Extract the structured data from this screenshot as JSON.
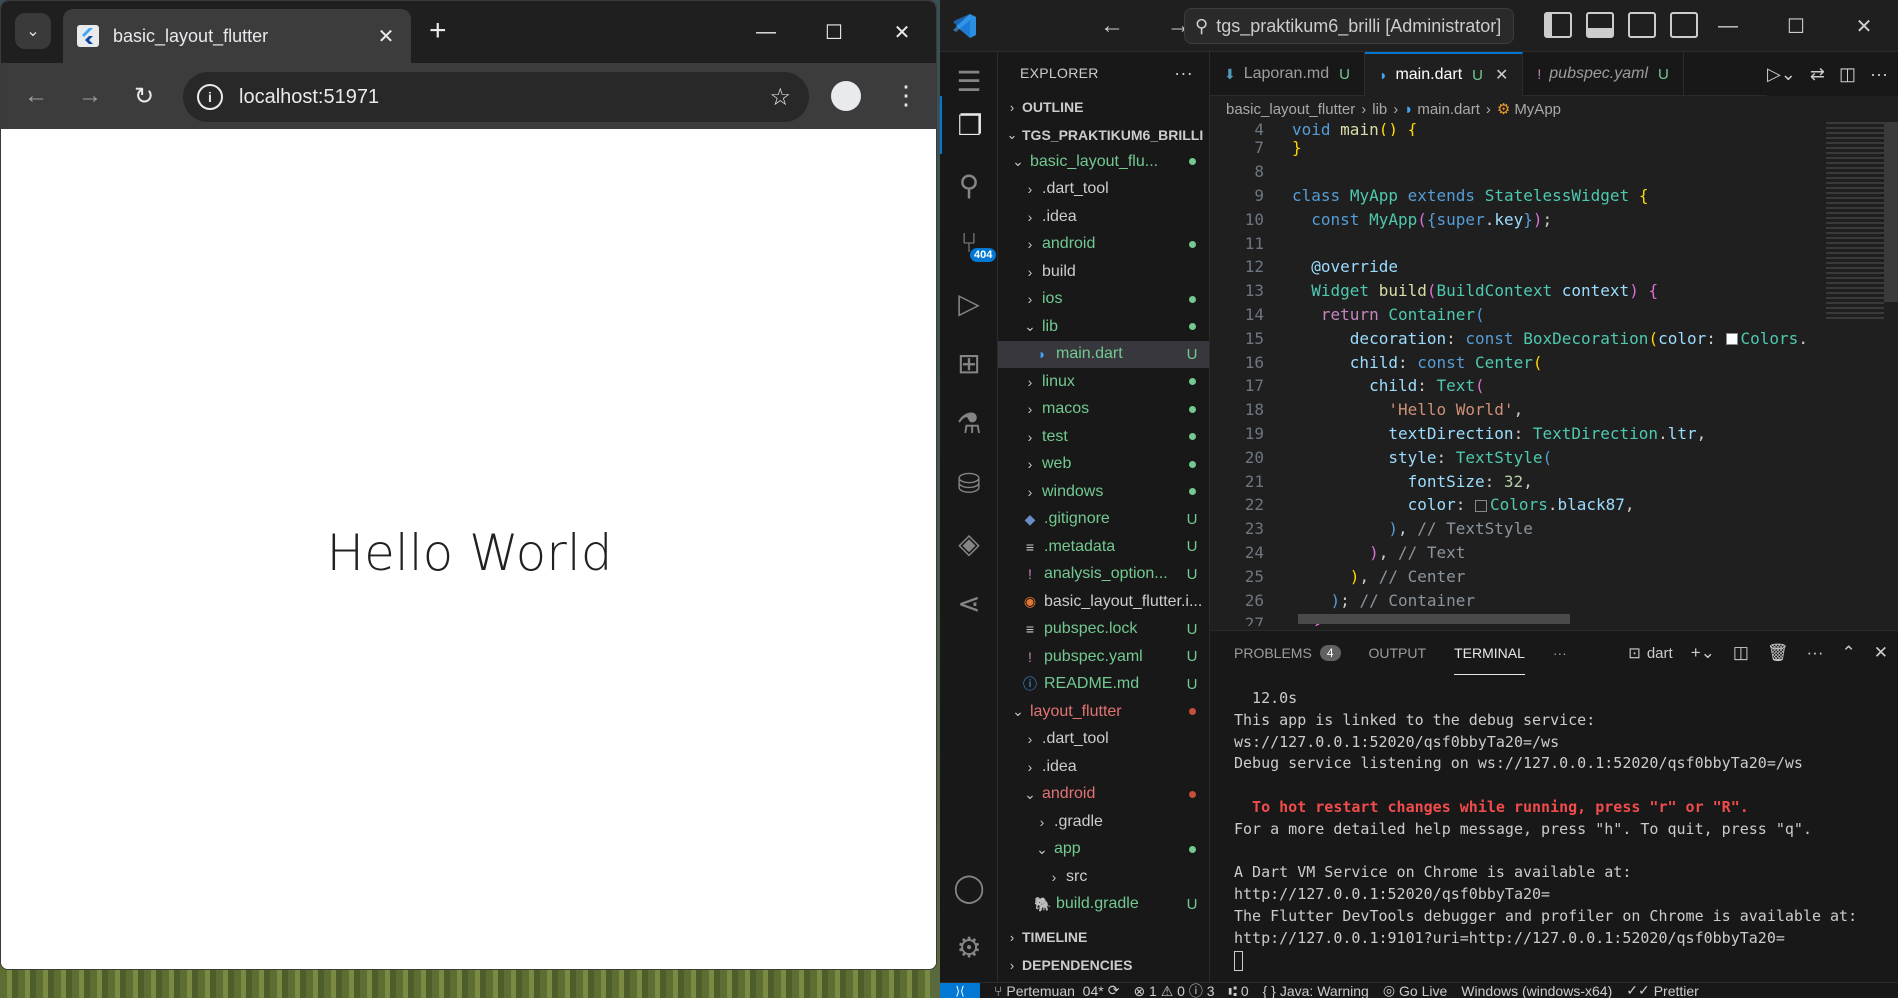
{
  "browser": {
    "tab_title": "basic_layout_flutter",
    "url": "localhost:51971",
    "page_text": "Hello World"
  },
  "vscode": {
    "command_center": "tgs_praktikum6_brilli [Administrator]",
    "explorer_title": "EXPLORER",
    "sections": {
      "outline": "OUTLINE",
      "workspace": "TGS_PRAKTIKUM6_BRILLI",
      "timeline": "TIMELINE",
      "dependencies": "DEPENDENCIES"
    },
    "scm_badge": "404",
    "tree": [
      {
        "label": "basic_layout_flu...",
        "indent": 1,
        "chevron": "⌄",
        "icon": "",
        "status": "dot-green"
      },
      {
        "label": ".dart_tool",
        "indent": 2,
        "chevron": "›",
        "icon": "",
        "status": ""
      },
      {
        "label": ".idea",
        "indent": 2,
        "chevron": "›",
        "icon": "",
        "status": ""
      },
      {
        "label": "android",
        "indent": 2,
        "chevron": "›",
        "icon": "",
        "status": "dot-green"
      },
      {
        "label": "build",
        "indent": 2,
        "chevron": "›",
        "icon": "",
        "status": ""
      },
      {
        "label": "ios",
        "indent": 2,
        "chevron": "›",
        "icon": "",
        "status": "dot-green"
      },
      {
        "label": "lib",
        "indent": 2,
        "chevron": "⌄",
        "icon": "",
        "status": "dot-green"
      },
      {
        "label": "main.dart",
        "indent": 3,
        "chevron": "",
        "icon": "dart",
        "status": "U",
        "selected": true
      },
      {
        "label": "linux",
        "indent": 2,
        "chevron": "›",
        "icon": "",
        "status": "dot-green"
      },
      {
        "label": "macos",
        "indent": 2,
        "chevron": "›",
        "icon": "",
        "status": "dot-green"
      },
      {
        "label": "test",
        "indent": 2,
        "chevron": "›",
        "icon": "",
        "status": "dot-green"
      },
      {
        "label": "web",
        "indent": 2,
        "chevron": "›",
        "icon": "",
        "status": "dot-green"
      },
      {
        "label": "windows",
        "indent": 2,
        "chevron": "›",
        "icon": "",
        "status": "dot-green"
      },
      {
        "label": ".gitignore",
        "indent": 2,
        "chevron": "",
        "icon": "git",
        "status": "U"
      },
      {
        "label": ".metadata",
        "indent": 2,
        "chevron": "",
        "icon": "lines",
        "status": "U"
      },
      {
        "label": "analysis_option...",
        "indent": 2,
        "chevron": "",
        "icon": "yaml",
        "status": "U"
      },
      {
        "label": "basic_layout_flutter.i...",
        "indent": 2,
        "chevron": "",
        "icon": "rss",
        "status": ""
      },
      {
        "label": "pubspec.lock",
        "indent": 2,
        "chevron": "",
        "icon": "lines",
        "status": "U"
      },
      {
        "label": "pubspec.yaml",
        "indent": 2,
        "chevron": "",
        "icon": "yaml",
        "status": "U"
      },
      {
        "label": "README.md",
        "indent": 2,
        "chevron": "",
        "icon": "info",
        "status": "U"
      },
      {
        "label": "layout_flutter",
        "indent": 1,
        "chevron": "⌄",
        "icon": "",
        "status": "dot-red",
        "red": true
      },
      {
        "label": ".dart_tool",
        "indent": 2,
        "chevron": "›",
        "icon": "",
        "status": ""
      },
      {
        "label": ".idea",
        "indent": 2,
        "chevron": "›",
        "icon": "",
        "status": ""
      },
      {
        "label": "android",
        "indent": 2,
        "chevron": "⌄",
        "icon": "",
        "status": "dot-red",
        "red": true
      },
      {
        "label": ".gradle",
        "indent": 3,
        "chevron": "›",
        "icon": "",
        "status": ""
      },
      {
        "label": "app",
        "indent": 3,
        "chevron": "⌄",
        "icon": "",
        "status": "dot-green"
      },
      {
        "label": "src",
        "indent": 4,
        "chevron": "›",
        "icon": "",
        "status": ""
      },
      {
        "label": "build.gradle",
        "indent": 3,
        "chevron": "",
        "icon": "gradle",
        "status": "U"
      }
    ],
    "tabs": [
      {
        "label": "Laporan.md",
        "status": "U",
        "icon": "md",
        "active": false
      },
      {
        "label": "main.dart",
        "status": "U",
        "icon": "dart",
        "active": true
      },
      {
        "label": "pubspec.yaml",
        "status": "U",
        "icon": "yaml",
        "active": false,
        "italic": true
      }
    ],
    "breadcrumb": [
      "basic_layout_flutter",
      "lib",
      "main.dart",
      "MyApp"
    ],
    "code_lines": [
      4,
      7,
      8,
      9,
      10,
      11,
      12,
      13,
      14,
      15,
      16,
      17,
      18,
      19,
      20,
      21,
      22,
      23,
      24,
      25,
      26,
      27
    ],
    "panel": {
      "tabs": [
        "PROBLEMS",
        "OUTPUT",
        "TERMINAL"
      ],
      "problems_count": "4",
      "shell": "dart",
      "terminal_lines": [
        "  12.0s",
        "This app is linked to the debug service:",
        "ws://127.0.0.1:52020/qsf0bbyTa20=/ws",
        "Debug service listening on ws://127.0.0.1:52020/qsf0bbyTa20=/ws",
        "",
        "  To hot restart changes while running, press \"r\" or \"R\".",
        "For a more detailed help message, press \"h\". To quit, press \"q\".",
        "",
        "A Dart VM Service on Chrome is available at:",
        "http://127.0.0.1:52020/qsf0bbyTa20=",
        "The Flutter DevTools debugger and profiler on Chrome is available at:",
        "http://127.0.0.1:9101?uri=http://127.0.0.1:52020/qsf0bbyTa20="
      ]
    },
    "statusbar": {
      "branch": "Pertemuan_04*",
      "problems": "⊗ 1 ⚠ 0 ⓘ 3",
      "ports": "⑆ 0",
      "java": "Java: Warning",
      "golive": "Go Live",
      "platform": "Windows (windows-x64)",
      "prettier": "Prettier"
    }
  }
}
